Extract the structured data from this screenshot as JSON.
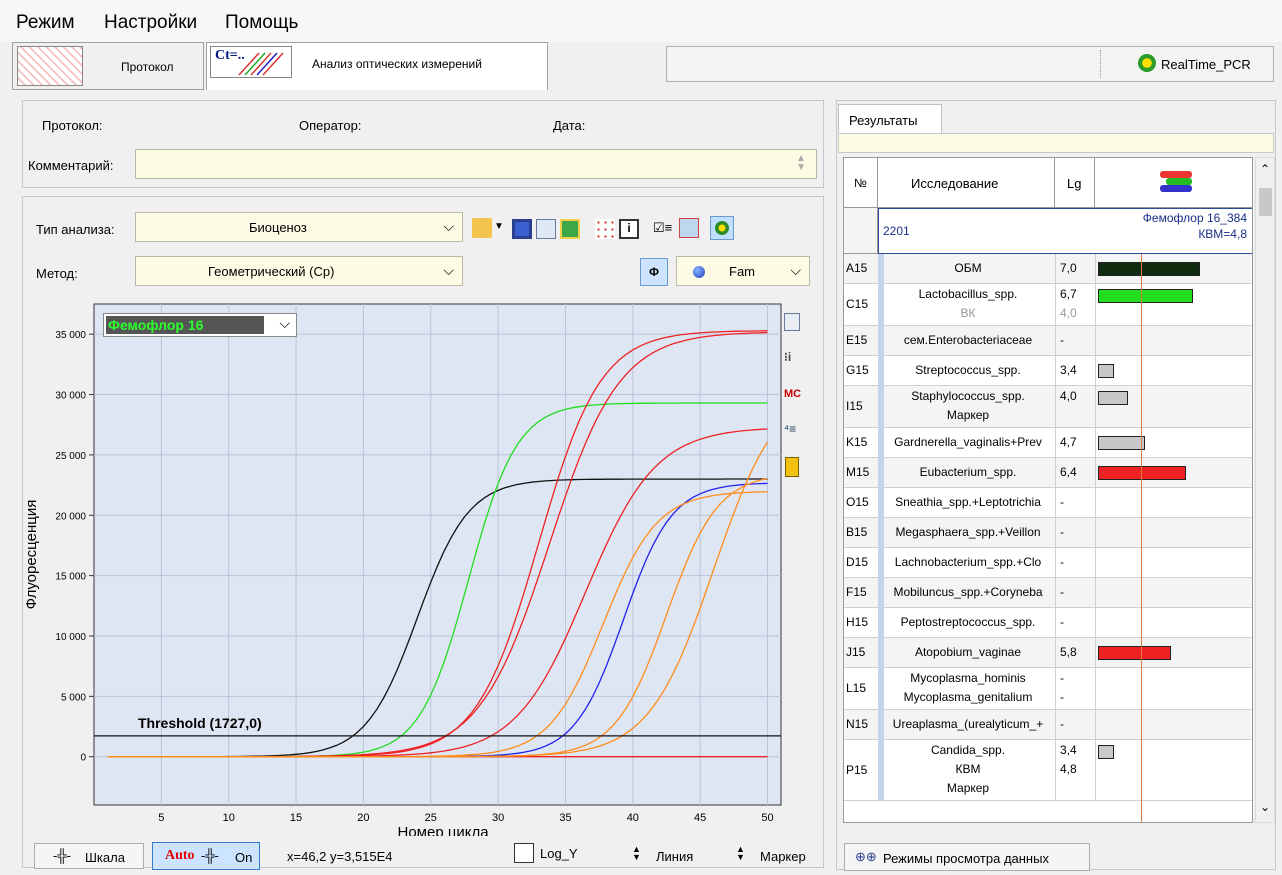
{
  "menu": [
    "Режим",
    "Настройки",
    "Помощь"
  ],
  "tabs": {
    "protocol": "Протокол",
    "analysis": "Анализ оптических измерений",
    "device": "RealTime_PCR"
  },
  "info": {
    "protocol": "Протокол:",
    "operator": "Оператор:",
    "date": "Дата:",
    "comment": "Комментарий:"
  },
  "analysis": {
    "type_label": "Тип анализа:",
    "type_value": "Биоценоз",
    "method_label": "Метод:",
    "method_value": "Геометрический (Ср)",
    "phi": "Φ",
    "channel": "Fam"
  },
  "chart_selector": "Фемофлор 16",
  "threshold_label": "Threshold (1727,0)",
  "bottom": {
    "scale": "Шкала",
    "auto": "Auto",
    "on": "On",
    "coords": "x=46,2 y=3,515E4",
    "logy": "Log_Y",
    "line": "Линия",
    "marker": "Маркер"
  },
  "results": {
    "tab": "Результаты",
    "headers": {
      "n": "№",
      "study": "Исследование",
      "lg": "Lg"
    },
    "sample": "2201",
    "sample_info1": "Фемофлор 16_384",
    "sample_info2": "КВМ=4,8",
    "rows": [
      {
        "well": "A15",
        "lines": [
          {
            "name": "ОБМ",
            "lg": "7,0"
          }
        ],
        "bar": 7.0,
        "color": "#0f2a0f"
      },
      {
        "well": "C15",
        "lines": [
          {
            "name": "Lactobacillus_spp.",
            "lg": "6,7"
          },
          {
            "name": "ВК",
            "lg": "4,0",
            "gray": true
          }
        ],
        "bar": 6.7,
        "color": "#22dd22"
      },
      {
        "well": "E15",
        "lines": [
          {
            "name": "сем.Enterobacteriaceae",
            "lg": "-"
          }
        ],
        "bar": null,
        "color": ""
      },
      {
        "well": "G15",
        "lines": [
          {
            "name": "Streptococcus_spp.",
            "lg": "3,4"
          }
        ],
        "bar": 3.4,
        "color": "#c8c8c8"
      },
      {
        "well": "I15",
        "lines": [
          {
            "name": "Staphylococcus_spp.",
            "lg": "4,0"
          },
          {
            "name": "Маркер",
            "lg": ""
          }
        ],
        "bar": 4.0,
        "color": "#c8c8c8"
      },
      {
        "well": "K15",
        "lines": [
          {
            "name": "Gardnerella_vaginalis+Prev",
            "lg": "4,7"
          }
        ],
        "bar": 4.7,
        "color": "#c8c8c8"
      },
      {
        "well": "M15",
        "lines": [
          {
            "name": "Eubacterium_spp.",
            "lg": "6,4"
          }
        ],
        "bar": 6.4,
        "color": "#ee2222"
      },
      {
        "well": "O15",
        "lines": [
          {
            "name": "Sneathia_spp.+Leptotrichia",
            "lg": "-"
          }
        ],
        "bar": null,
        "color": ""
      },
      {
        "well": "B15",
        "lines": [
          {
            "name": "Megasphaera_spp.+Veillon",
            "lg": "-"
          }
        ],
        "bar": null,
        "color": ""
      },
      {
        "well": "D15",
        "lines": [
          {
            "name": "Lachnobacterium_spp.+Clo",
            "lg": "-"
          }
        ],
        "bar": null,
        "color": ""
      },
      {
        "well": "F15",
        "lines": [
          {
            "name": "Mobiluncus_spp.+Coryneba",
            "lg": "-"
          }
        ],
        "bar": null,
        "color": ""
      },
      {
        "well": "H15",
        "lines": [
          {
            "name": "Peptostreptococcus_spp.",
            "lg": "-"
          }
        ],
        "bar": null,
        "color": ""
      },
      {
        "well": "J15",
        "lines": [
          {
            "name": "Atopobium_vaginae",
            "lg": "5,8"
          }
        ],
        "bar": 5.8,
        "color": "#ee2222"
      },
      {
        "well": "L15",
        "lines": [
          {
            "name": "Mycoplasma_hominis",
            "lg": "-"
          },
          {
            "name": "Mycoplasma_genitalium",
            "lg": "-"
          }
        ],
        "bar": null,
        "color": ""
      },
      {
        "well": "N15",
        "lines": [
          {
            "name": "Ureaplasma_(urealyticum_+",
            "lg": "-"
          }
        ],
        "bar": null,
        "color": ""
      },
      {
        "well": "P15",
        "lines": [
          {
            "name": "Candida_spp.",
            "lg": "3,4"
          },
          {
            "name": "КВМ",
            "lg": "4,8"
          },
          {
            "name": "Маркер",
            "lg": ""
          }
        ],
        "bar": 3.4,
        "color": "#c8c8c8"
      }
    ],
    "view_modes": "Режимы просмотра данных"
  },
  "chart_data": {
    "type": "line",
    "xlabel": "Номер цикла",
    "ylabel": "Флуоресценция",
    "xlim": [
      0,
      51
    ],
    "ylim": [
      -4000,
      37500
    ],
    "xticks": [
      5,
      10,
      15,
      20,
      25,
      30,
      35,
      40,
      45,
      50
    ],
    "xtick_labels": [
      "5",
      "10",
      "15",
      "20",
      "25",
      "30",
      "35",
      "40",
      "45",
      "50"
    ],
    "yticks": [
      0,
      5000,
      10000,
      15000,
      20000,
      25000,
      30000,
      35000
    ],
    "ytick_labels": [
      "0",
      "5 000",
      "10 000",
      "15 000",
      "20 000",
      "25 000",
      "30 000",
      "35 000"
    ],
    "threshold": 1727,
    "series": [
      {
        "color": "#111111",
        "plateau": 23000,
        "ct": 24.0,
        "slope": 1.9
      },
      {
        "color": "#22dd22",
        "plateau": 29300,
        "ct": 27.8,
        "slope": 1.8
      },
      {
        "color": "#ee2222",
        "plateau": 35300,
        "ct": 33.0,
        "slope": 2.3
      },
      {
        "color": "#ee2222",
        "plateau": 35200,
        "ct": 33.8,
        "slope": 2.6
      },
      {
        "color": "#ee2222",
        "plateau": 27300,
        "ct": 36.5,
        "slope": 2.6
      },
      {
        "color": "#ee2222",
        "plateau": 0,
        "ct": 40.0,
        "slope": 2.0
      },
      {
        "color": "#2222ee",
        "plateau": 22700,
        "ct": 39.3,
        "slope": 1.8
      },
      {
        "color": "#ff8c1a",
        "plateau": 22000,
        "ct": 37.8,
        "slope": 2.0
      },
      {
        "color": "#ff8c1a",
        "plateau": 23500,
        "ct": 42.5,
        "slope": 1.9
      },
      {
        "color": "#ff8c1a",
        "plateau": 31000,
        "ct": 46.0,
        "slope": 2.4
      }
    ]
  }
}
